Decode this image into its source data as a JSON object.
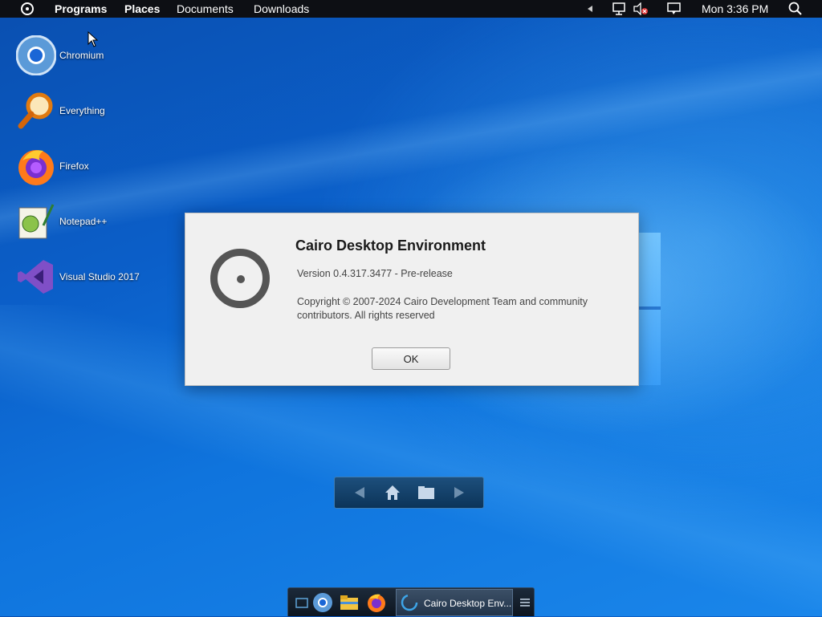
{
  "menubar": {
    "items": [
      "Programs",
      "Places",
      "Documents",
      "Downloads"
    ],
    "clock": "Mon 3:36 PM"
  },
  "desktop_icons": [
    {
      "label": "Chromium",
      "icon": "chromium-icon"
    },
    {
      "label": "Everything",
      "icon": "everything-search-icon"
    },
    {
      "label": "Firefox",
      "icon": "firefox-icon"
    },
    {
      "label": "Notepad++",
      "icon": "notepadplusplus-icon"
    },
    {
      "label": "Visual Studio 2017",
      "icon": "visual-studio-icon"
    }
  ],
  "dialog": {
    "title": "Cairo Desktop Environment",
    "version": "Version 0.4.317.3477 - Pre-release",
    "copyright": "Copyright © 2007-2024 Cairo Development Team and community contributors.  All rights reserved",
    "ok_label": "OK"
  },
  "taskbar": {
    "active_window": "Cairo Desktop Env..."
  },
  "colors": {
    "menubar_bg": "#0d0f14",
    "dialog_bg": "#f0f0f0",
    "desktop_blue": "#0b5fc9"
  }
}
